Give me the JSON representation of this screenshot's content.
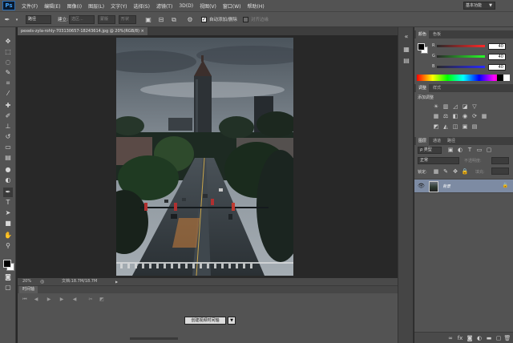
{
  "app": {
    "logo": "Ps"
  },
  "menu": [
    "文件(F)",
    "编辑(E)",
    "图像(I)",
    "图层(L)",
    "文字(Y)",
    "选择(S)",
    "滤镜(T)",
    "3D(D)",
    "视图(V)",
    "窗口(W)",
    "帮助(H)"
  ],
  "workspace": "基本功能",
  "options": {
    "mode": "路径",
    "build_label": "建立:",
    "selection_btn": "选区...",
    "mask_btn": "蒙版",
    "shape_btn": "形状",
    "auto_add_delete": "自动添加/删除",
    "align_edges": "对齐边缘"
  },
  "document": {
    "tab_title": "pexels-zyla-rohly-703130657-18243614.jpg @ 20%(RGB/8)",
    "zoom": "20%",
    "doc_info": "文档:18.7M/18.7M"
  },
  "timeline": {
    "tab": "时间轴",
    "create_button": "创建视频时间轴"
  },
  "color_panel": {
    "tabs": [
      "颜色",
      "色板"
    ],
    "r_label": "R",
    "g_label": "G",
    "b_label": "B",
    "r": "40",
    "g": "40",
    "b": "40"
  },
  "adjustments_panel": {
    "tabs": [
      "调整",
      "样式"
    ],
    "title": "添加调整"
  },
  "layers_panel": {
    "tabs": [
      "图层",
      "通道",
      "路径"
    ],
    "kind": "类型",
    "blend_mode": "正常",
    "opacity_label": "不透明度:",
    "lock_label": "锁定:",
    "fill_label": "填充:",
    "layer_name": "背景"
  },
  "colors": {
    "ui_gray": "#535353",
    "canvas_bg": "#282828",
    "layer_selected": "#7d8ba3",
    "ps_blue": "#3d9cf0"
  }
}
